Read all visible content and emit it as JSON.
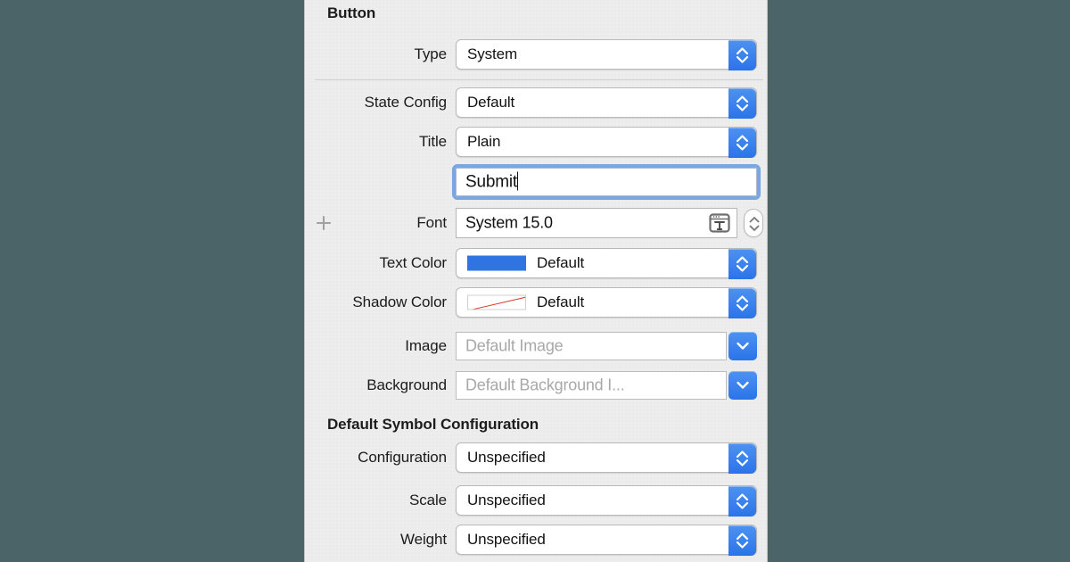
{
  "panel": {
    "section_button": "Button",
    "section_symbol": "Default Symbol Configuration"
  },
  "rows": {
    "type": {
      "label": "Type",
      "value": "System"
    },
    "state_config": {
      "label": "State Config",
      "value": "Default"
    },
    "title": {
      "label": "Title",
      "value": "Plain"
    },
    "title_text": {
      "value": "Submit"
    },
    "font": {
      "label": "Font",
      "value": "System 15.0",
      "add_label": "+"
    },
    "text_color": {
      "label": "Text Color",
      "value": "Default"
    },
    "shadow_color": {
      "label": "Shadow Color",
      "value": "Default"
    },
    "image": {
      "label": "Image",
      "placeholder": "Default Image"
    },
    "background": {
      "label": "Background",
      "placeholder": "Default Background I..."
    },
    "configuration": {
      "label": "Configuration",
      "value": "Unspecified"
    },
    "scale": {
      "label": "Scale",
      "value": "Unspecified"
    },
    "weight": {
      "label": "Weight",
      "value": "Unspecified"
    }
  },
  "colors": {
    "accent_blue": "#2a74e8",
    "text_color_swatch": "#2f74e0",
    "shadow_slash": "#d9402f",
    "focus_ring": "#7ba7e0",
    "panel_background": "#ececec",
    "desktop_background": "#4a6468"
  }
}
